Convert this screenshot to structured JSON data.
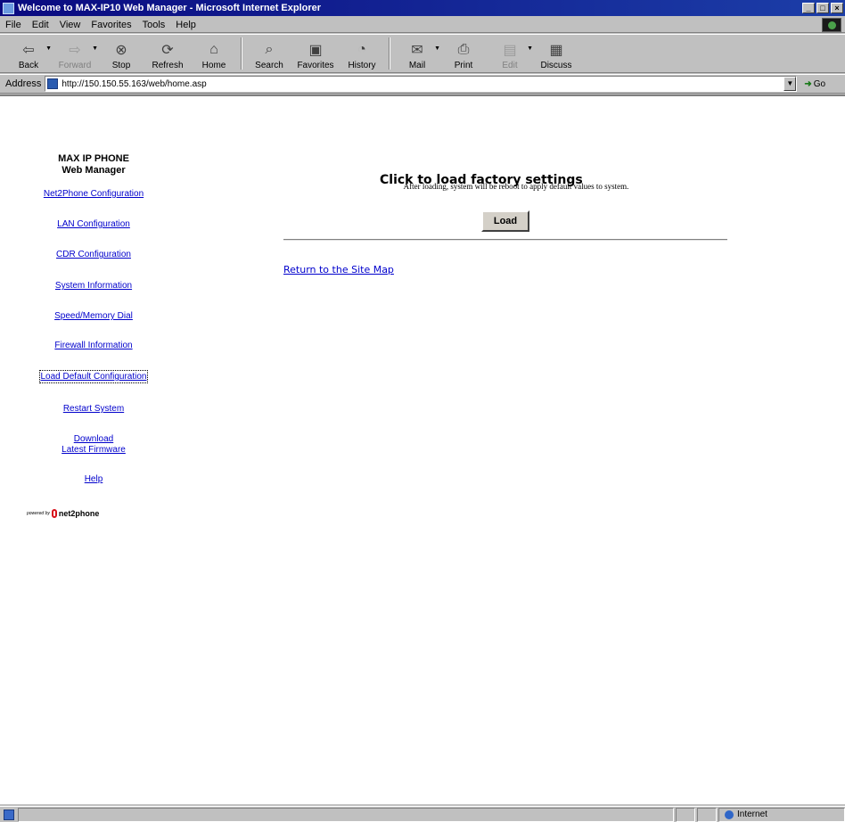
{
  "window": {
    "title": "Welcome to MAX-IP10 Web Manager - Microsoft Internet Explorer",
    "buttons": [
      "_",
      "□",
      "×"
    ]
  },
  "menu": {
    "items": [
      {
        "label": "File",
        "accel": "F"
      },
      {
        "label": "Edit",
        "accel": "E"
      },
      {
        "label": "View",
        "accel": "V"
      },
      {
        "label": "Favorites",
        "accel": "a"
      },
      {
        "label": "Tools",
        "accel": "T"
      },
      {
        "label": "Help",
        "accel": "H"
      }
    ]
  },
  "toolbar": {
    "back": "Back",
    "forward": "Forward",
    "stop": "Stop",
    "refresh": "Refresh",
    "home": "Home",
    "search": "Search",
    "favorites": "Favorites",
    "history": "History",
    "mail": "Mail",
    "print": "Print",
    "edit": "Edit",
    "discuss": "Discuss"
  },
  "address": {
    "label": "Address",
    "url": "http://150.150.55.163/web/home.asp",
    "go": "Go"
  },
  "sidebar": {
    "title_line1": "MAX IP PHONE",
    "title_line2": "Web Manager",
    "items": [
      {
        "label": "Net2Phone Configuration"
      },
      {
        "label": "LAN Configuration"
      },
      {
        "label": "CDR Configuration"
      },
      {
        "label": "System Information"
      },
      {
        "label": "Speed/Memory Dial"
      },
      {
        "label": "Firewall Information"
      },
      {
        "label": "Load Default Configuration"
      },
      {
        "label": "Restart System"
      },
      {
        "label": "Download"
      },
      {
        "label": "Latest Firmware"
      },
      {
        "label": "Help"
      }
    ],
    "powered_by": "powered by",
    "brand": "net2phone"
  },
  "main": {
    "heading": "Click to load factory settings",
    "description": "After loading, system will be reboot to apply default values to system.",
    "load_button": "Load",
    "return_link": "Return to the Site Map"
  },
  "status": {
    "zone": "Internet"
  }
}
